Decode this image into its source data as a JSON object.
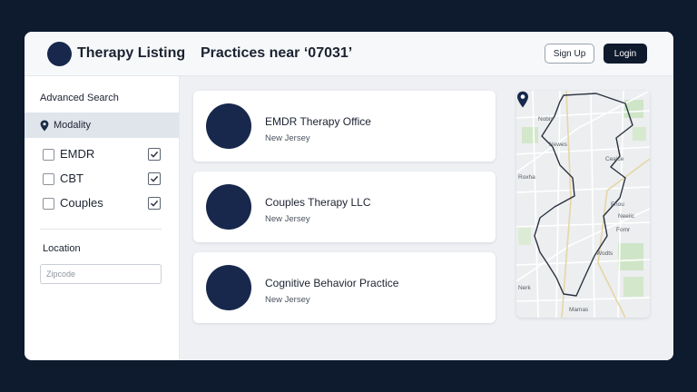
{
  "header": {
    "brand": "Therapy Listing",
    "page_title": "Practices near ‘07031’",
    "signup_label": "Sign Up",
    "login_label": "Login"
  },
  "sidebar": {
    "advanced_search_label": "Advanced Search",
    "modality_label": "Modality",
    "options": [
      {
        "label": "EMDR",
        "checked": true
      },
      {
        "label": "CBT",
        "checked": true
      },
      {
        "label": "Couples",
        "checked": true
      }
    ],
    "location_label": "Location",
    "zip_placeholder": "Zipcode"
  },
  "results": [
    {
      "name": "EMDR Therapy Office",
      "state": "New Jersey"
    },
    {
      "name": "Couples Therapy LLC",
      "state": "New Jersey"
    },
    {
      "name": "Cognitive Behavior Practice",
      "state": "New Jersey"
    }
  ],
  "map": {
    "labels": [
      "Nobis",
      "Newes",
      "Roxha",
      "Ceaice",
      "Neeiic",
      "Fomr",
      "Wodts",
      "Mamas",
      "Nerk",
      "Fnou"
    ]
  },
  "colors": {
    "background": "#0e1a2e",
    "brand_navy": "#17284c",
    "login_button": "#0f1a2c",
    "sidebar_highlight": "#e0e5ec",
    "main_bg": "#eef0f3"
  },
  "icons": {
    "logo": "circle-logo-icon",
    "modality": "map-pin-icon",
    "map_marker": "map-marker-icon"
  }
}
